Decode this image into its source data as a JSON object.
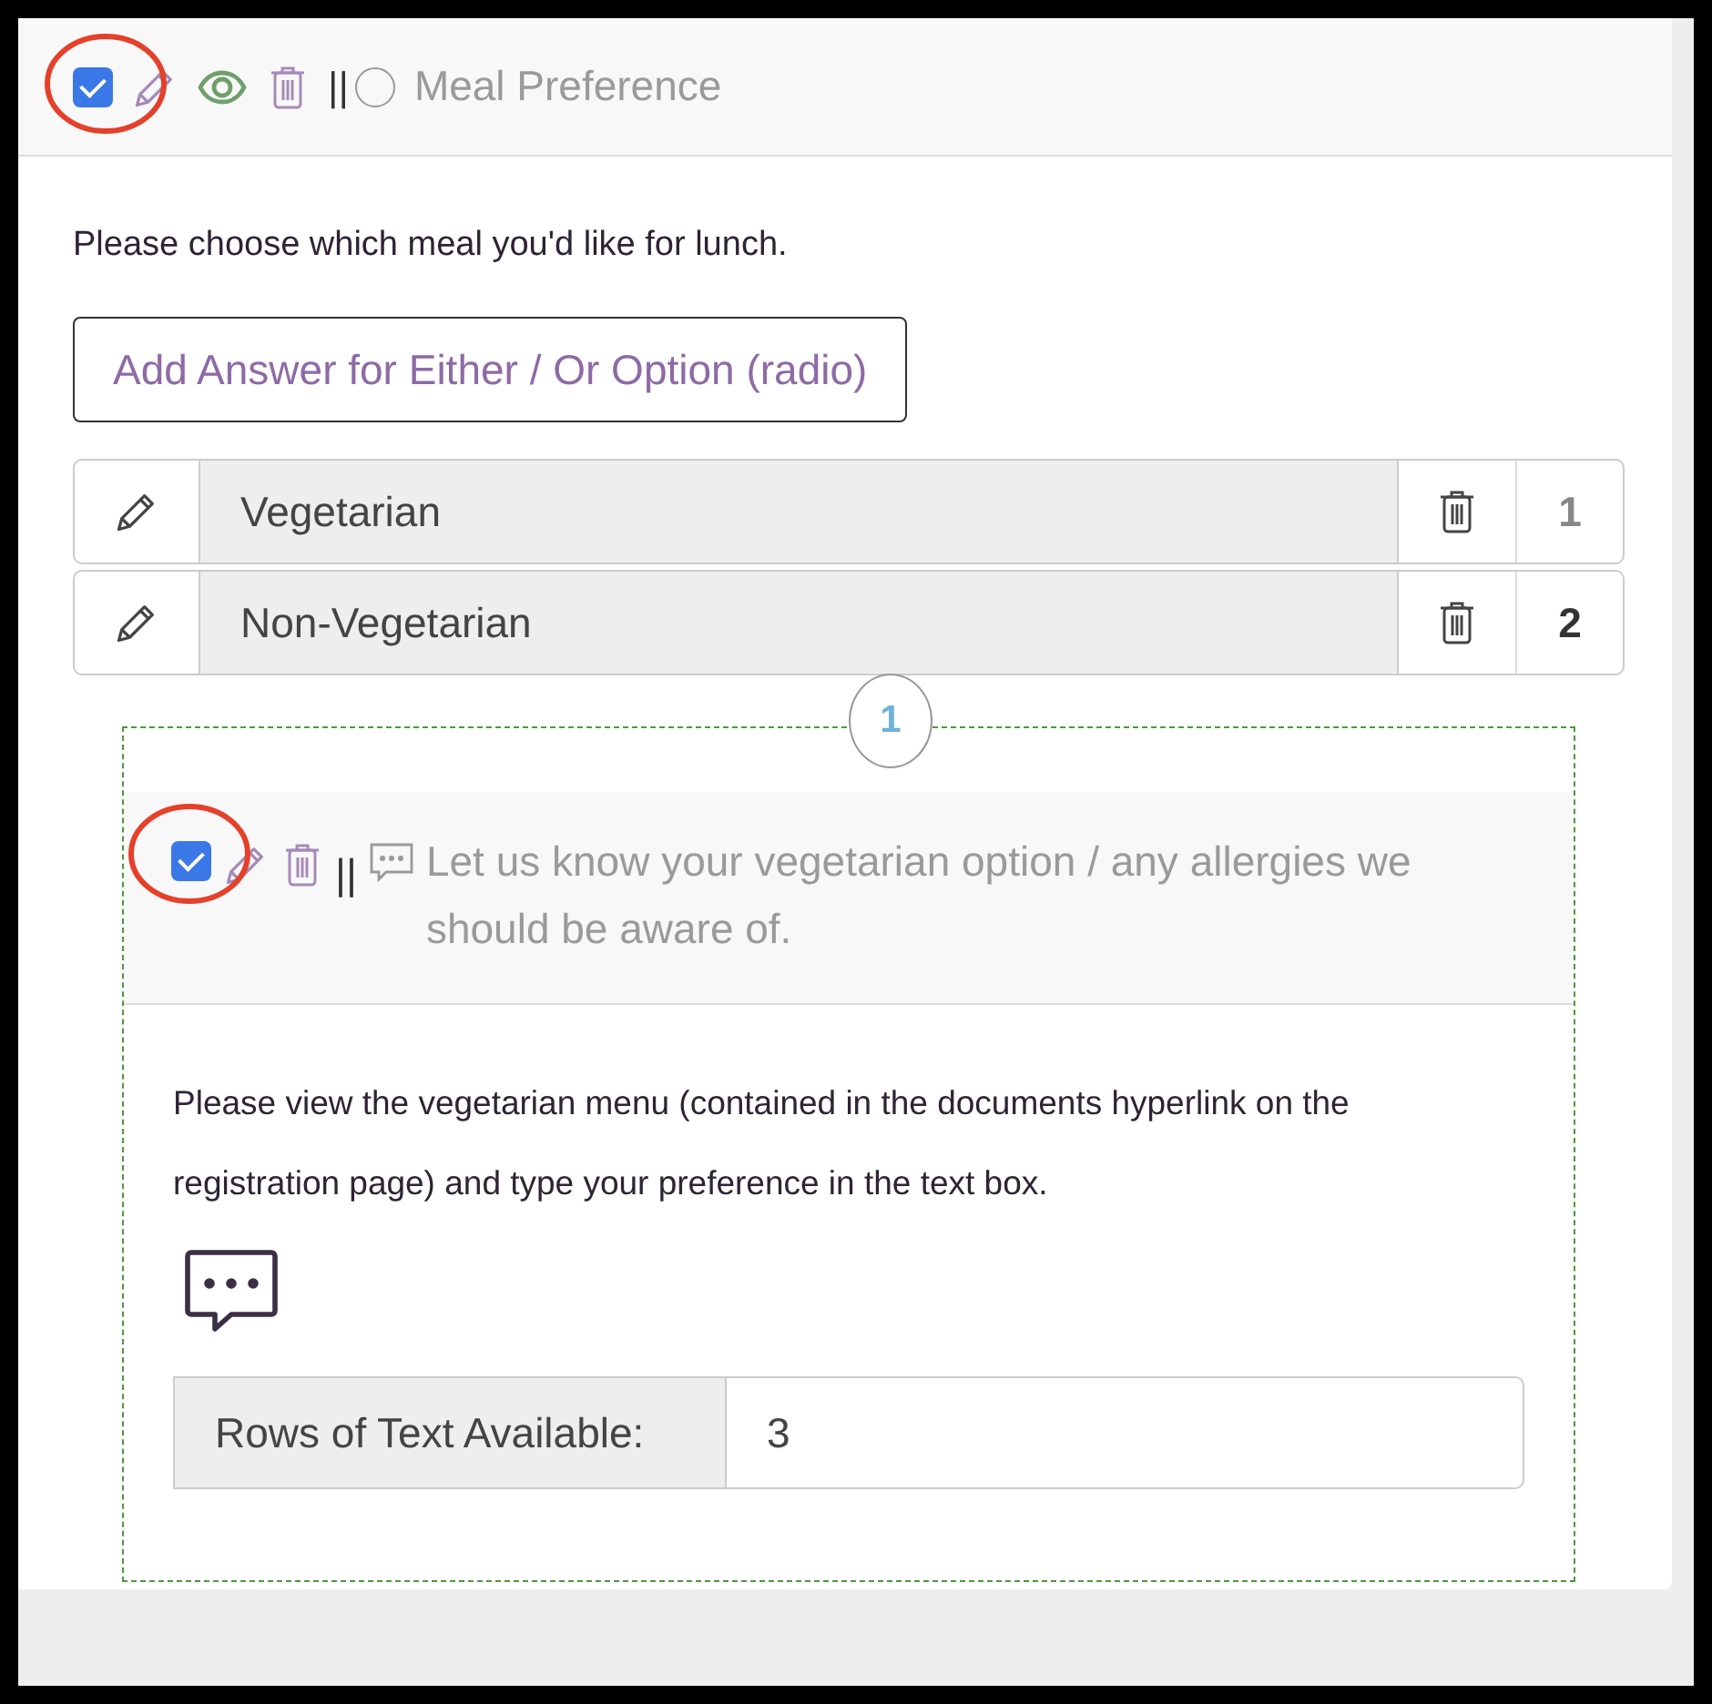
{
  "question": {
    "checked": true,
    "highlighted": true,
    "title": "Meal Preference",
    "description": "Please choose which meal you'd like for lunch.",
    "add_button": "Add Answer for Either / Or Option (radio)",
    "answers": [
      {
        "label": "Vegetarian",
        "number": "1",
        "selected": false
      },
      {
        "label": "Non-Vegetarian",
        "number": "2",
        "selected": true
      }
    ],
    "branch_badge": "1",
    "sub_question": {
      "checked": true,
      "highlighted": true,
      "separator": "||",
      "title": "Let us know your vegetarian option / any allergies we should be aware of.",
      "description": "Please view the vegetarian menu (contained in the documents hyperlink on the registration page) and type your preference in the text box.",
      "rows_label": "Rows of Text Available:",
      "rows_value": "3"
    },
    "separator": "||"
  }
}
